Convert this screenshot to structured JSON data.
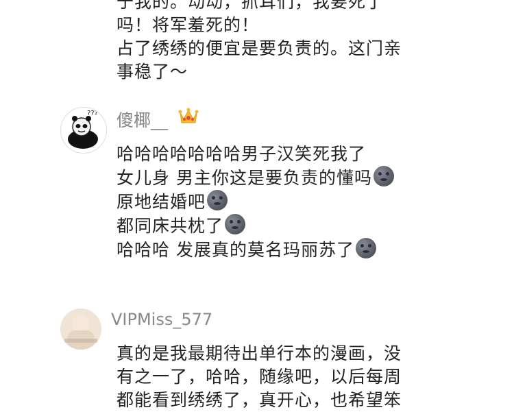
{
  "comment_1": {
    "lines": [
      "于我的。动动，抓耳们，我要死了",
      "吗！将军羞死的！",
      "占了绣绣的便宜是要负责的。这门亲",
      "事稳了～"
    ]
  },
  "comment_2": {
    "username": "傻椰__",
    "badge_icon": "crown-icon",
    "lines": [
      "哈哈哈哈哈哈哈男子汉笑死我了",
      "女儿身 男主你这是要负责的懂吗",
      "原地结婚吧",
      "都同床共枕了",
      "哈哈哈 发展真的莫名玛丽苏了"
    ],
    "emoji": "moon-face-icon"
  },
  "comment_3": {
    "username": "VIPMiss_577",
    "lines": [
      "真的是我最期待出单行本的漫画，没",
      "有之一了，哈哈，随缘吧，以后每周",
      "都能看到绣绣了，真开心，也希望笨"
    ]
  }
}
